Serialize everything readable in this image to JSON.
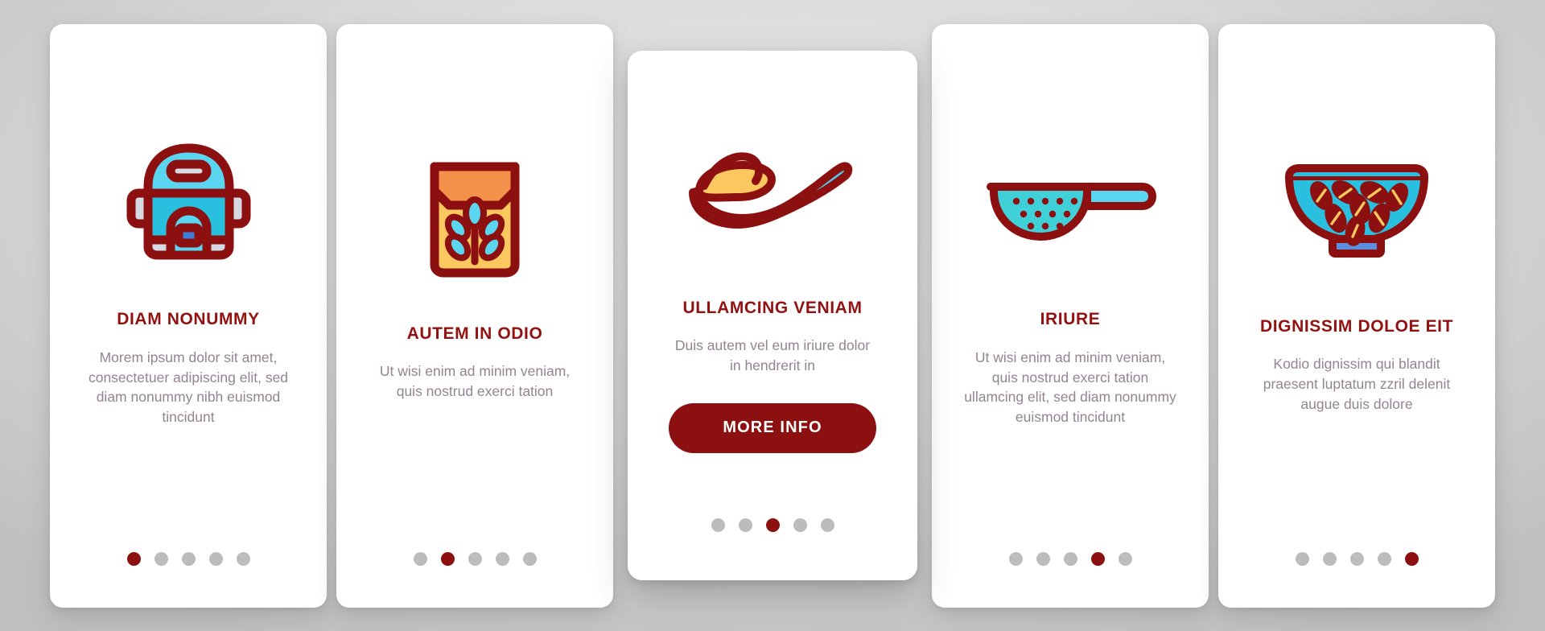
{
  "theme": {
    "accent_red": "#8C1010",
    "title_red": "#921212",
    "body_gray": "#938493",
    "card_bg": "#ffffff",
    "dot_inactive": "#bcbcbc",
    "icon_cyan": "#29C0E0",
    "icon_light_blue": "#7EE0F5",
    "icon_pale": "#D5DAE3",
    "icon_orange": "#F4914B",
    "icon_yellow": "#FBC85F",
    "icon_blue": "#3E7FD8",
    "background": "#d6d6d6"
  },
  "screens": [
    {
      "id": "diam-nonummy",
      "icon": "rice-cooker-icon",
      "title": "DIAM NONUMMY",
      "body": "Morem ipsum dolor sit amet, consectetuer adipiscing elit, sed diam nonummy nibh euismod tincidunt",
      "featured": false,
      "dot_count": 5,
      "active_dot": 1
    },
    {
      "id": "autem-in-odio",
      "icon": "flour-bag-icon",
      "title": "AUTEM IN ODIO",
      "body": "Ut wisi enim ad minim veniam, quis nostrud exerci tation",
      "featured": false,
      "dot_count": 5,
      "active_dot": 2
    },
    {
      "id": "ullamcing-veniam",
      "icon": "spoon-with-powder-icon",
      "title": "ULLAMCING VENIAM",
      "body": "Duis autem vel eum iriure dolor in hendrerit in",
      "featured": true,
      "cta_label": "MORE INFO",
      "dot_count": 5,
      "active_dot": 3
    },
    {
      "id": "iriure",
      "icon": "sieve-strainer-icon",
      "title": "IRIURE",
      "body": "Ut wisi enim ad minim veniam, quis nostrud exerci tation ullamcing elit, sed diam nonummy euismod tincidunt",
      "featured": false,
      "dot_count": 5,
      "active_dot": 4
    },
    {
      "id": "dignissim-doloe-eit",
      "icon": "grain-bowl-icon",
      "title": "DIGNISSIM DOLOE EIT",
      "body": "Kodio dignissim qui blandit praesent luptatum zzril delenit augue duis dolore",
      "featured": false,
      "dot_count": 5,
      "active_dot": 5
    }
  ]
}
